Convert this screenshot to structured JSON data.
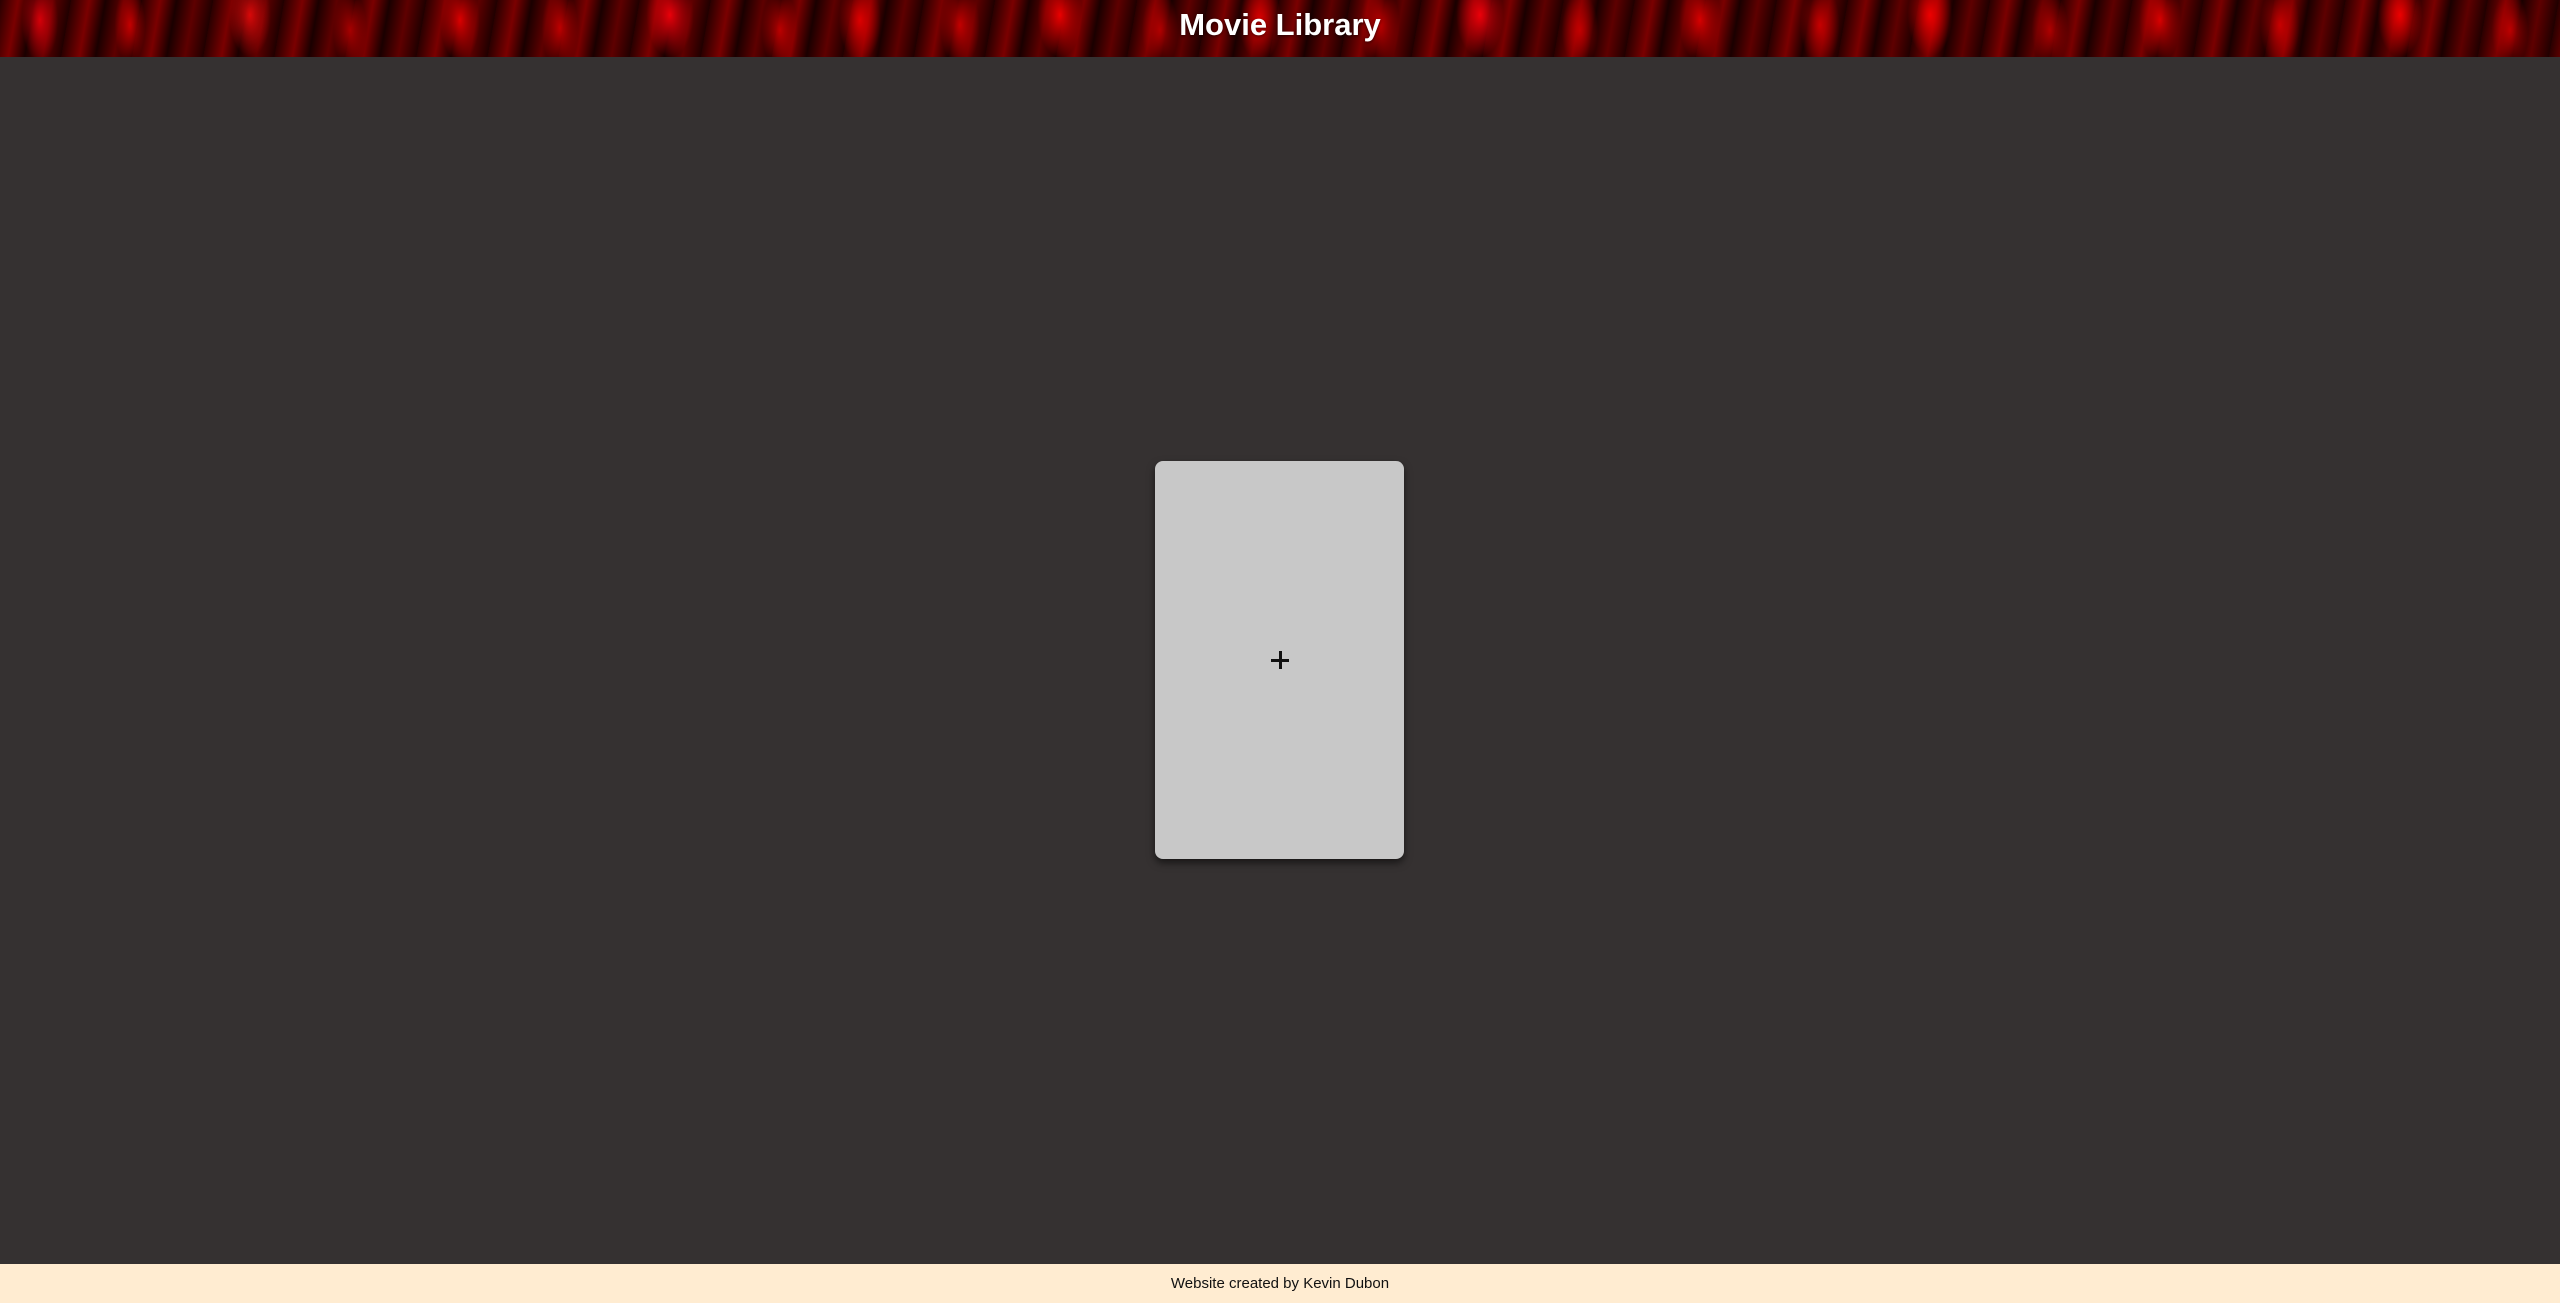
{
  "header": {
    "title": "Movie Library"
  },
  "main": {
    "add_card": {
      "icon": "plus-icon"
    }
  },
  "footer": {
    "text": "Website created by Kevin Dubon"
  },
  "colors": {
    "background": "#353131",
    "card": "#c8c8c8",
    "footer": "#ffecd1",
    "header_accent": "#e00000"
  }
}
